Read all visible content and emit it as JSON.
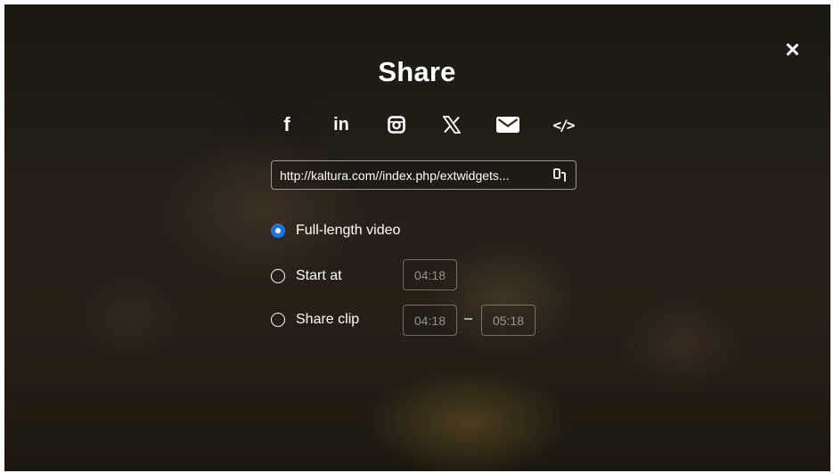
{
  "dialog": {
    "title": "Share"
  },
  "social_icons": [
    {
      "name": "facebook-icon",
      "glyph": "f"
    },
    {
      "name": "linkedin-icon",
      "glyph": "in"
    },
    {
      "name": "instagram-icon",
      "glyph": ""
    },
    {
      "name": "x-icon",
      "glyph": "𝕏"
    },
    {
      "name": "email-icon",
      "glyph": ""
    },
    {
      "name": "embed-icon",
      "glyph": "</>"
    }
  ],
  "share_url": {
    "value": "http://kaltura.com//index.php/extwidgets..."
  },
  "options": {
    "full_length": {
      "label": "Full-length video",
      "checked": true
    },
    "start_at": {
      "label": "Start at",
      "time": "04:18",
      "checked": false
    },
    "share_clip": {
      "label": "Share clip",
      "start": "04:18",
      "end": "05:18",
      "checked": false
    }
  },
  "colors": {
    "accent": "#1a73e8",
    "text": "#ffffff"
  }
}
